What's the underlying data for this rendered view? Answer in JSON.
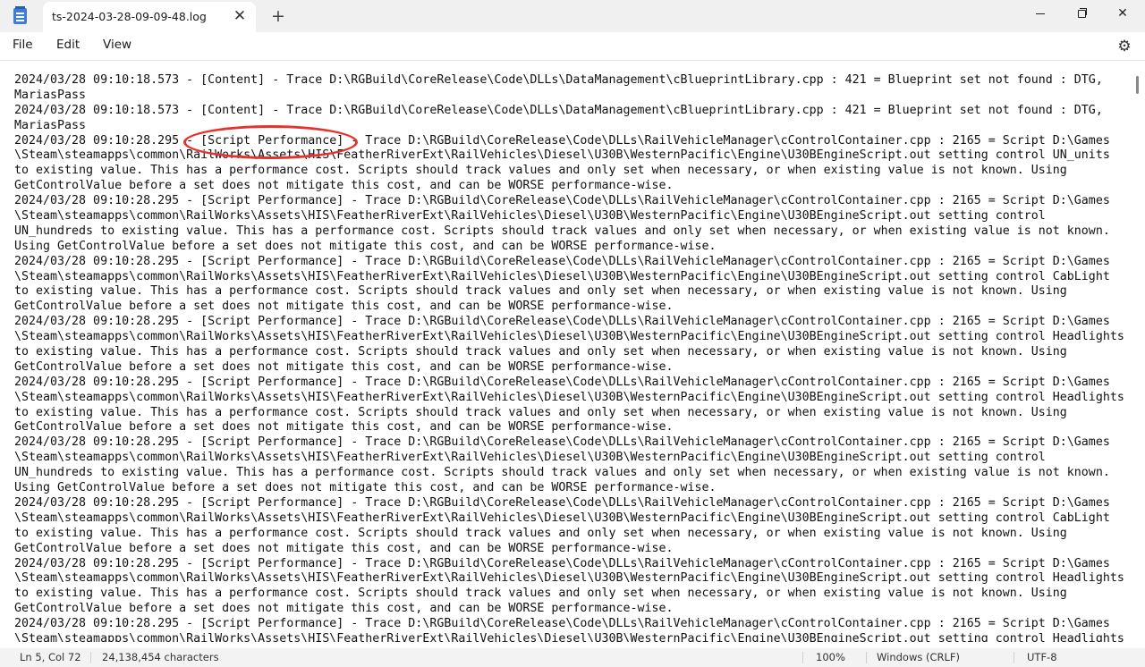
{
  "window": {
    "tab_title": "ts-2024-03-28-09-09-48.log",
    "tab_close": "✕",
    "new_tab": "+",
    "close_glyph": "✕"
  },
  "menu": {
    "file": "File",
    "edit": "Edit",
    "view": "View",
    "settings_icon": "⚙"
  },
  "editor": {
    "lines": [
      "2024/03/28 09:10:18.573 - [Content] - Trace D:\\RGBuild\\CoreRelease\\Code\\DLLs\\DataManagement\\cBlueprintLibrary.cpp : 421 = Blueprint set not found : DTG,",
      "MariasPass",
      "2024/03/28 09:10:18.573 - [Content] - Trace D:\\RGBuild\\CoreRelease\\Code\\DLLs\\DataManagement\\cBlueprintLibrary.cpp : 421 = Blueprint set not found : DTG,",
      "MariasPass",
      "2024/03/28 09:10:28.295 - [Script Performance] - Trace D:\\RGBuild\\CoreRelease\\Code\\DLLs\\RailVehicleManager\\cControlContainer.cpp : 2165 = Script D:\\Games",
      "\\Steam\\steamapps\\common\\RailWorks\\Assets\\HIS\\FeatherRiverExt\\RailVehicles\\Diesel\\U30B\\WesternPacific\\Engine\\U30BEngineScript.out setting control UN_units",
      "to existing value. This has a performance cost. Scripts should track values and only set when necessary, or when existing value is not known. Using",
      "GetControlValue before a set does not mitigate this cost, and can be WORSE performance-wise.",
      "2024/03/28 09:10:28.295 - [Script Performance] - Trace D:\\RGBuild\\CoreRelease\\Code\\DLLs\\RailVehicleManager\\cControlContainer.cpp : 2165 = Script D:\\Games",
      "\\Steam\\steamapps\\common\\RailWorks\\Assets\\HIS\\FeatherRiverExt\\RailVehicles\\Diesel\\U30B\\WesternPacific\\Engine\\U30BEngineScript.out setting control",
      "UN_hundreds to existing value. This has a performance cost. Scripts should track values and only set when necessary, or when existing value is not known.",
      "Using GetControlValue before a set does not mitigate this cost, and can be WORSE performance-wise.",
      "2024/03/28 09:10:28.295 - [Script Performance] - Trace D:\\RGBuild\\CoreRelease\\Code\\DLLs\\RailVehicleManager\\cControlContainer.cpp : 2165 = Script D:\\Games",
      "\\Steam\\steamapps\\common\\RailWorks\\Assets\\HIS\\FeatherRiverExt\\RailVehicles\\Diesel\\U30B\\WesternPacific\\Engine\\U30BEngineScript.out setting control CabLight",
      "to existing value. This has a performance cost. Scripts should track values and only set when necessary, or when existing value is not known. Using",
      "GetControlValue before a set does not mitigate this cost, and can be WORSE performance-wise.",
      "2024/03/28 09:10:28.295 - [Script Performance] - Trace D:\\RGBuild\\CoreRelease\\Code\\DLLs\\RailVehicleManager\\cControlContainer.cpp : 2165 = Script D:\\Games",
      "\\Steam\\steamapps\\common\\RailWorks\\Assets\\HIS\\FeatherRiverExt\\RailVehicles\\Diesel\\U30B\\WesternPacific\\Engine\\U30BEngineScript.out setting control Headlights",
      "to existing value. This has a performance cost. Scripts should track values and only set when necessary, or when existing value is not known. Using",
      "GetControlValue before a set does not mitigate this cost, and can be WORSE performance-wise.",
      "2024/03/28 09:10:28.295 - [Script Performance] - Trace D:\\RGBuild\\CoreRelease\\Code\\DLLs\\RailVehicleManager\\cControlContainer.cpp : 2165 = Script D:\\Games",
      "\\Steam\\steamapps\\common\\RailWorks\\Assets\\HIS\\FeatherRiverExt\\RailVehicles\\Diesel\\U30B\\WesternPacific\\Engine\\U30BEngineScript.out setting control Headlights",
      "to existing value. This has a performance cost. Scripts should track values and only set when necessary, or when existing value is not known. Using",
      "GetControlValue before a set does not mitigate this cost, and can be WORSE performance-wise.",
      "2024/03/28 09:10:28.295 - [Script Performance] - Trace D:\\RGBuild\\CoreRelease\\Code\\DLLs\\RailVehicleManager\\cControlContainer.cpp : 2165 = Script D:\\Games",
      "\\Steam\\steamapps\\common\\RailWorks\\Assets\\HIS\\FeatherRiverExt\\RailVehicles\\Diesel\\U30B\\WesternPacific\\Engine\\U30BEngineScript.out setting control",
      "UN_hundreds to existing value. This has a performance cost. Scripts should track values and only set when necessary, or when existing value is not known.",
      "Using GetControlValue before a set does not mitigate this cost, and can be WORSE performance-wise.",
      "2024/03/28 09:10:28.295 - [Script Performance] - Trace D:\\RGBuild\\CoreRelease\\Code\\DLLs\\RailVehicleManager\\cControlContainer.cpp : 2165 = Script D:\\Games",
      "\\Steam\\steamapps\\common\\RailWorks\\Assets\\HIS\\FeatherRiverExt\\RailVehicles\\Diesel\\U30B\\WesternPacific\\Engine\\U30BEngineScript.out setting control CabLight",
      "to existing value. This has a performance cost. Scripts should track values and only set when necessary, or when existing value is not known. Using",
      "GetControlValue before a set does not mitigate this cost, and can be WORSE performance-wise.",
      "2024/03/28 09:10:28.295 - [Script Performance] - Trace D:\\RGBuild\\CoreRelease\\Code\\DLLs\\RailVehicleManager\\cControlContainer.cpp : 2165 = Script D:\\Games",
      "\\Steam\\steamapps\\common\\RailWorks\\Assets\\HIS\\FeatherRiverExt\\RailVehicles\\Diesel\\U30B\\WesternPacific\\Engine\\U30BEngineScript.out setting control Headlights",
      "to existing value. This has a performance cost. Scripts should track values and only set when necessary, or when existing value is not known. Using",
      "GetControlValue before a set does not mitigate this cost, and can be WORSE performance-wise.",
      "2024/03/28 09:10:28.295 - [Script Performance] - Trace D:\\RGBuild\\CoreRelease\\Code\\DLLs\\RailVehicleManager\\cControlContainer.cpp : 2165 = Script D:\\Games",
      "\\Steam\\steamapps\\common\\RailWorks\\Assets\\HIS\\FeatherRiverExt\\RailVehicles\\Diesel\\U30B\\WesternPacific\\Engine\\U30BEngineScript.out setting control Headlights"
    ]
  },
  "status": {
    "position": "Ln 5, Col 72",
    "characters": "24,138,454 characters",
    "zoom": "100%",
    "line_ending": "Windows (CRLF)",
    "encoding": "UTF-8"
  },
  "colors": {
    "annotation": "#e5322d",
    "titlebar": "#f0f0f0",
    "statusbar": "#f3f3f3"
  }
}
